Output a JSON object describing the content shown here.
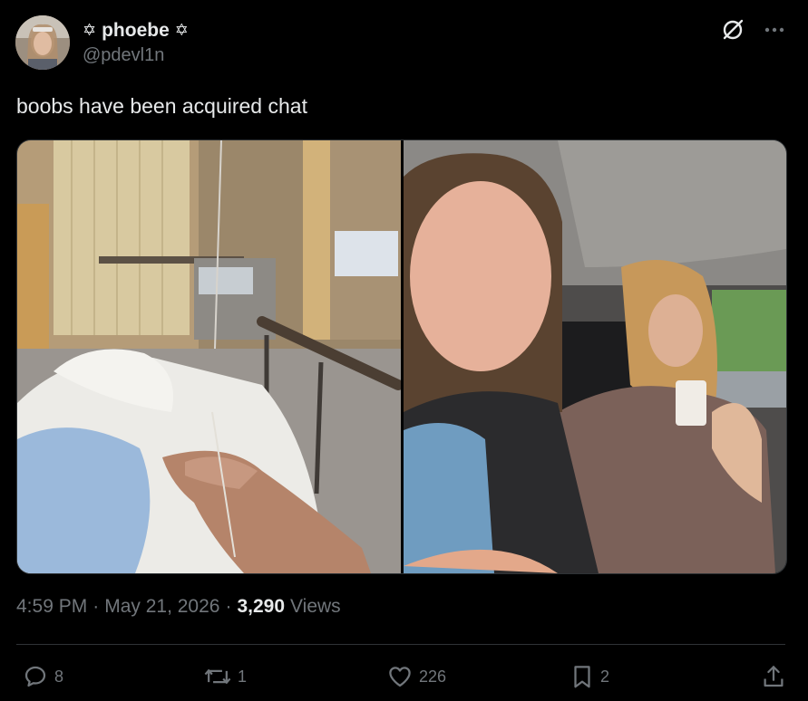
{
  "author": {
    "display_name": "phoebe",
    "star_left": "✡",
    "star_right": "✡",
    "handle": "@pdevl1n"
  },
  "tweet": {
    "text": "boobs have been acquired chat"
  },
  "meta": {
    "time": "4:59 PM",
    "separator1": "·",
    "date": "May 21, 2026",
    "separator2": "·",
    "views_count": "3,290",
    "views_label": "Views"
  },
  "engagement": {
    "replies": "8",
    "reposts": "1",
    "likes": "226",
    "bookmarks": "2"
  },
  "icons": {
    "grok": "grok-icon",
    "more": "more-icon",
    "reply": "reply-icon",
    "repost": "repost-icon",
    "like": "like-icon",
    "bookmark": "bookmark-icon",
    "share": "share-icon"
  },
  "colors": {
    "background": "#000000",
    "text_primary": "#e7e9ea",
    "text_secondary": "#71767b",
    "divider": "#2f3336"
  }
}
